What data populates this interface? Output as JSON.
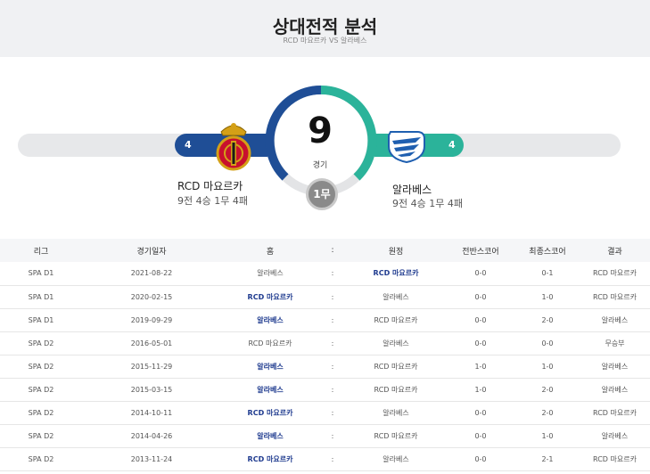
{
  "header": {
    "title": "상대전적 분석",
    "subtitle": "RCD 마요르카 VS 알라베스"
  },
  "summary": {
    "total_games": "9",
    "games_label": "경기",
    "draws_label": "1무",
    "home": {
      "name": "RCD 마요르카",
      "record": "9전 4승 1무 4패",
      "wins": "4",
      "win_fraction": 0.44
    },
    "away": {
      "name": "알라베스",
      "record": "9전 4승 1무 4패",
      "wins": "4",
      "win_fraction": 0.44
    },
    "colors": {
      "home": "#1f4e96",
      "away": "#2bb39a",
      "draw": "#8a8a8a"
    }
  },
  "table": {
    "headers": [
      "리그",
      "경기일자",
      "홈",
      ":",
      "원정",
      "전반스코어",
      "최종스코어",
      "결과"
    ],
    "rows": [
      {
        "league": "SPA D1",
        "date": "2021-08-22",
        "home": "알라베스",
        "sep": ":",
        "away": "RCD 마요르카",
        "half": "0-0",
        "final": "0-1",
        "result": "RCD 마요르카",
        "winner": "away"
      },
      {
        "league": "SPA D1",
        "date": "2020-02-15",
        "home": "RCD 마요르카",
        "sep": ":",
        "away": "알라베스",
        "half": "0-0",
        "final": "1-0",
        "result": "RCD 마요르카",
        "winner": "home"
      },
      {
        "league": "SPA D1",
        "date": "2019-09-29",
        "home": "알라베스",
        "sep": ":",
        "away": "RCD 마요르카",
        "half": "0-0",
        "final": "2-0",
        "result": "알라베스",
        "winner": "home"
      },
      {
        "league": "SPA D2",
        "date": "2016-05-01",
        "home": "RCD 마요르카",
        "sep": ":",
        "away": "알라베스",
        "half": "0-0",
        "final": "0-0",
        "result": "무승부",
        "winner": "none"
      },
      {
        "league": "SPA D2",
        "date": "2015-11-29",
        "home": "알라베스",
        "sep": ":",
        "away": "RCD 마요르카",
        "half": "1-0",
        "final": "1-0",
        "result": "알라베스",
        "winner": "home"
      },
      {
        "league": "SPA D2",
        "date": "2015-03-15",
        "home": "알라베스",
        "sep": ":",
        "away": "RCD 마요르카",
        "half": "1-0",
        "final": "2-0",
        "result": "알라베스",
        "winner": "home"
      },
      {
        "league": "SPA D2",
        "date": "2014-10-11",
        "home": "RCD 마요르카",
        "sep": ":",
        "away": "알라베스",
        "half": "0-0",
        "final": "2-0",
        "result": "RCD 마요르카",
        "winner": "home"
      },
      {
        "league": "SPA D2",
        "date": "2014-04-26",
        "home": "알라베스",
        "sep": ":",
        "away": "RCD 마요르카",
        "half": "0-0",
        "final": "1-0",
        "result": "알라베스",
        "winner": "home"
      },
      {
        "league": "SPA D2",
        "date": "2013-11-24",
        "home": "RCD 마요르카",
        "sep": ":",
        "away": "알라베스",
        "half": "0-0",
        "final": "2-1",
        "result": "RCD 마요르카",
        "winner": "home"
      }
    ]
  }
}
